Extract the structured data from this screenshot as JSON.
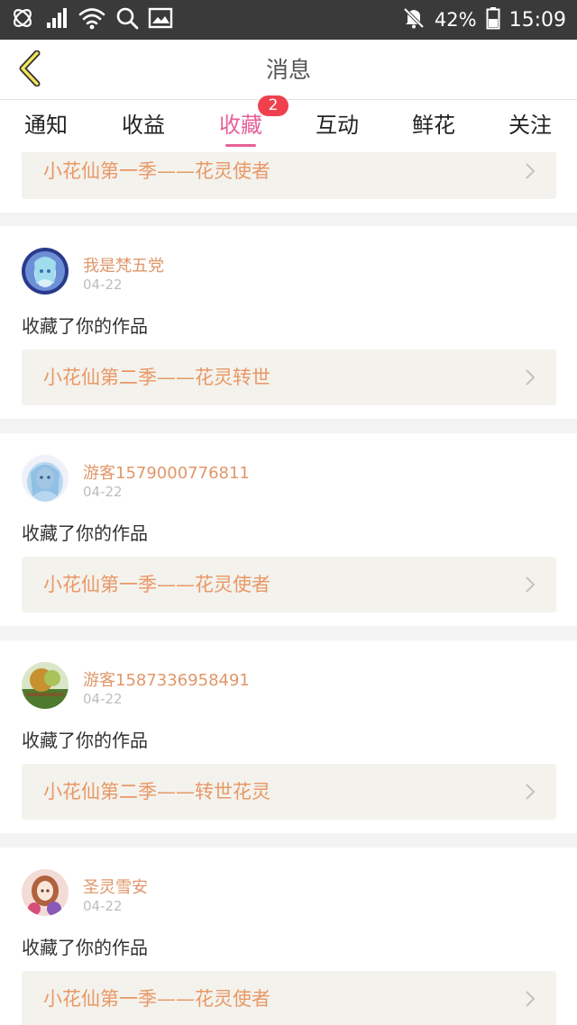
{
  "status_bar": {
    "battery": "42%",
    "time": "15:09",
    "left_icons": [
      "unicom-icon",
      "signal-icon",
      "wifi-icon",
      "search-icon",
      "image-icon"
    ],
    "right_icons": [
      "bell-off-icon",
      "battery-icon"
    ]
  },
  "header": {
    "title": "消息",
    "back_icon": "chevron-left-icon"
  },
  "tabs": [
    {
      "label": "通知"
    },
    {
      "label": "收益"
    },
    {
      "label": "收藏",
      "active": true,
      "badge": "2"
    },
    {
      "label": "互动"
    },
    {
      "label": "鲜花"
    },
    {
      "label": "关注"
    }
  ],
  "colors": {
    "accent": "#e7609a",
    "badge": "#f0404e",
    "username": "#e0976a",
    "work_title": "#e89867",
    "work_bg": "#f4f2ec"
  },
  "feed": {
    "partial_item": {
      "work_title": "小花仙第一季——花灵使者"
    },
    "items": [
      {
        "username": "我是梵五党",
        "date": "04-22",
        "action": "收藏了你的作品",
        "work_title": "小花仙第二季——花灵转世"
      },
      {
        "username": "游客1579000776811",
        "date": "04-22",
        "action": "收藏了你的作品",
        "work_title": "小花仙第一季——花灵使者"
      },
      {
        "username": "游客1587336958491",
        "date": "04-22",
        "action": "收藏了你的作品",
        "work_title": "小花仙第二季——转世花灵"
      },
      {
        "username": "圣灵雪安",
        "date": "04-22",
        "action": "收藏了你的作品",
        "work_title": "小花仙第一季——花灵使者"
      }
    ]
  }
}
